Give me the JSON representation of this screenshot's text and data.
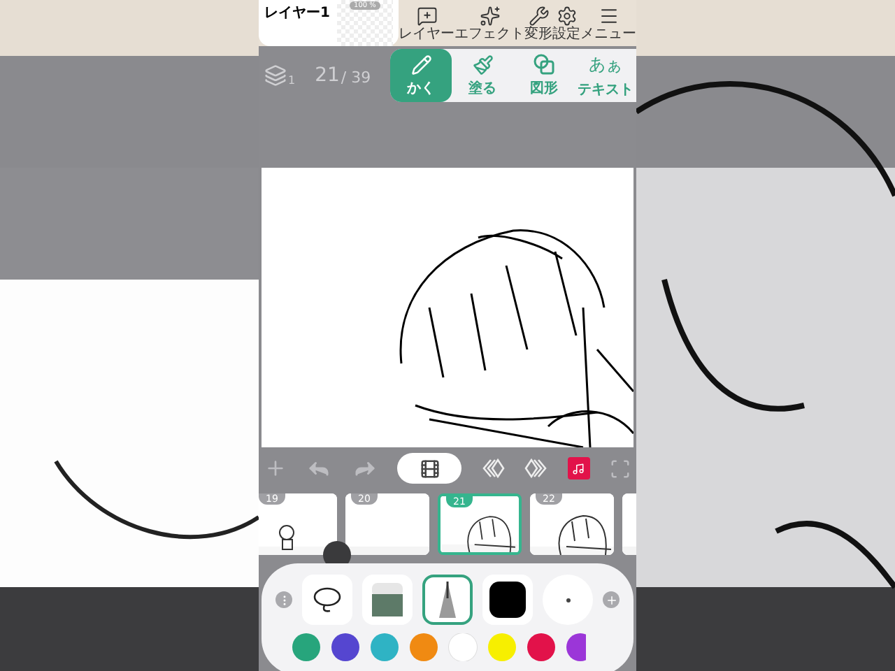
{
  "layer_card": {
    "name": "レイヤー1",
    "opacity": "100 %"
  },
  "top_menu": [
    {
      "kind": "layer",
      "label": "レイヤー"
    },
    {
      "kind": "effect",
      "label": "エフェクト"
    },
    {
      "kind": "transform",
      "label": "変形"
    },
    {
      "kind": "settings",
      "label": "設定"
    },
    {
      "kind": "menu",
      "label": "メニュー"
    }
  ],
  "frame_counter": {
    "layers": "1",
    "current": "21",
    "total": "/ 39"
  },
  "tool_tabs": [
    {
      "kind": "pen",
      "label": "かく",
      "selected": true
    },
    {
      "kind": "fill",
      "label": "塗る",
      "selected": false
    },
    {
      "kind": "shape",
      "label": "図形",
      "selected": false
    },
    {
      "kind": "text",
      "glyph": "あぁ",
      "label": "テキスト",
      "selected": false
    }
  ],
  "frames": [
    {
      "number": "19",
      "kind": "figure",
      "selected": false
    },
    {
      "number": "20",
      "kind": "blank",
      "selected": false
    },
    {
      "number": "21",
      "kind": "face",
      "selected": true
    },
    {
      "number": "22",
      "kind": "face",
      "selected": false
    },
    {
      "kind": "blank",
      "selected": false
    }
  ],
  "palette": {
    "tools": [
      {
        "kind": "lasso",
        "selected": false
      },
      {
        "kind": "eraser",
        "selected": false
      },
      {
        "kind": "pen",
        "selected": true
      },
      {
        "kind": "color",
        "color": "#000000",
        "selected": false
      },
      {
        "kind": "size",
        "selected": false
      }
    ],
    "colors": [
      {
        "color": "#27a57c"
      },
      {
        "color": "#5546d0"
      },
      {
        "color": "#2fb3c4"
      },
      {
        "color": "#f08a12"
      },
      {
        "color": "#ffffff"
      },
      {
        "color": "#f7ef00"
      },
      {
        "color": "#e2124a"
      },
      {
        "color": "#9b36d8"
      }
    ]
  }
}
